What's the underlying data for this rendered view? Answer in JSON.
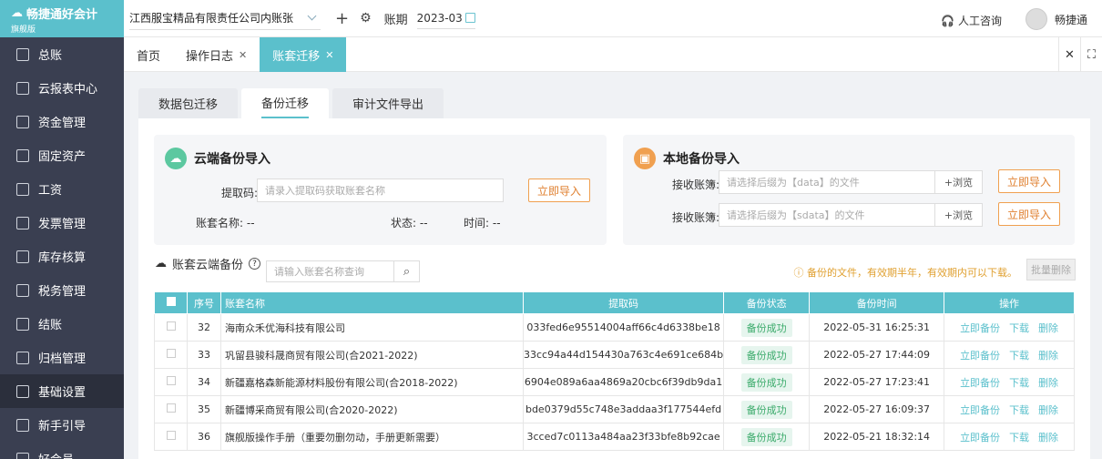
{
  "app": {
    "brand": "畅捷通好会计",
    "edition": "旗舰版"
  },
  "sidebar": {
    "items": [
      {
        "label": "总账",
        "icon": "ledger-icon"
      },
      {
        "label": "云报表中心",
        "icon": "chart-icon"
      },
      {
        "label": "资金管理",
        "icon": "wallet-icon"
      },
      {
        "label": "固定资产",
        "icon": "asset-icon"
      },
      {
        "label": "工资",
        "icon": "salary-icon"
      },
      {
        "label": "发票管理",
        "icon": "invoice-icon"
      },
      {
        "label": "库存核算",
        "icon": "inventory-icon"
      },
      {
        "label": "税务管理",
        "icon": "tax-icon"
      },
      {
        "label": "结账",
        "icon": "close-books-icon"
      },
      {
        "label": "归档管理",
        "icon": "archive-icon"
      },
      {
        "label": "基础设置",
        "icon": "gear-icon"
      },
      {
        "label": "新手引导",
        "icon": "guide-icon"
      },
      {
        "label": "好会员",
        "icon": "member-icon"
      }
    ],
    "active_index": 10
  },
  "topbar": {
    "company": "江西服宝精品有限责任公司内账张",
    "period_label": "账期",
    "period": "2023-03",
    "consult": "人工咨询",
    "user": "畅捷通"
  },
  "tabs": [
    {
      "label": "首页",
      "closable": false
    },
    {
      "label": "操作日志",
      "closable": true
    },
    {
      "label": "账套迁移",
      "closable": true
    }
  ],
  "subtabs": [
    "数据包迁移",
    "备份迁移",
    "审计文件导出"
  ],
  "cloud_import": {
    "title": "云端备份导入",
    "code_label": "提取码:",
    "code_placeholder": "请录入提取码获取账套名称",
    "import_btn": "立即导入",
    "name_label": "账套名称:",
    "name_value": "--",
    "status_label": "状态:",
    "status_value": "--",
    "time_label": "时间:",
    "time_value": "--"
  },
  "local_import": {
    "title": "本地备份导入",
    "rows": [
      {
        "label": "接收账簿:",
        "placeholder": "请选择后缀为【data】的文件",
        "browse": "+浏览",
        "import_btn": "立即导入"
      },
      {
        "label": "接收账簿:",
        "placeholder": "请选择后缀为【sdata】的文件",
        "browse": "+浏览",
        "import_btn": "立即导入"
      }
    ]
  },
  "cloud_backup": {
    "title": "账套云端备份",
    "search_placeholder": "请输入账套名称查询",
    "notice": "备份的文件，有效期半年，有效期内可以下载。",
    "bulk_delete": "批量删除"
  },
  "table": {
    "headers": [
      "序号",
      "账套名称",
      "提取码",
      "备份状态",
      "备份时间",
      "操作"
    ],
    "rows": [
      {
        "no": "32",
        "name": "海南众禾优海科技有限公司",
        "code": "033fed6e95514004aff66c4d6338be18",
        "status": "备份成功",
        "time": "2022-05-31 16:25:31"
      },
      {
        "no": "33",
        "name": "巩留县骏科晟商贸有限公司(合2021-2022)",
        "code": "33cc94a44d154430a763c4e691ce684b",
        "status": "备份成功",
        "time": "2022-05-27 17:44:09"
      },
      {
        "no": "34",
        "name": "新疆嘉格森新能源材料股份有限公司(合2018-2022)",
        "code": "6904e089a6aa4869a20cbc6f39db9da1",
        "status": "备份成功",
        "time": "2022-05-27 17:23:41"
      },
      {
        "no": "35",
        "name": "新疆博采商贸有限公司(合2020-2022)",
        "code": "bde0379d55c748e3addaa3f177544efd",
        "status": "备份成功",
        "time": "2022-05-27 16:09:37"
      },
      {
        "no": "36",
        "name": "旗舰版操作手册（重要勿删勿动，手册更新需要）",
        "code": "3cced7c0113a484aa23f33bfe8b92cae",
        "status": "备份成功",
        "time": "2022-05-21 18:32:14"
      }
    ],
    "actions": [
      "立即备份",
      "下载",
      "删除"
    ]
  }
}
